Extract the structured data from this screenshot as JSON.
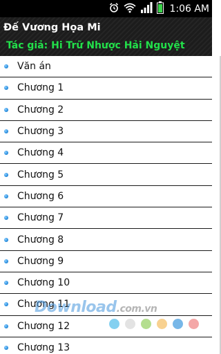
{
  "status_bar": {
    "time": "1:06 AM",
    "icons": [
      "alarm-icon",
      "wifi-icon",
      "signal-icon",
      "battery-icon"
    ]
  },
  "header": {
    "title": "Đế Vương Họa Mi",
    "author": "Tác giả: Hi Trữ Nhược Hải Nguyệt"
  },
  "chapters": [
    {
      "label": "Văn án"
    },
    {
      "label": "Chương 1"
    },
    {
      "label": "Chương 2"
    },
    {
      "label": "Chương 3"
    },
    {
      "label": "Chương 4"
    },
    {
      "label": "Chương 5"
    },
    {
      "label": "Chương 6"
    },
    {
      "label": "Chương 7"
    },
    {
      "label": "Chương 8"
    },
    {
      "label": "Chương 9"
    },
    {
      "label": "Chương 10"
    },
    {
      "label": "Chương 11"
    },
    {
      "label": "Chương 12"
    },
    {
      "label": "Chương 13"
    }
  ],
  "watermark": {
    "brand": "Download",
    "domain": ".com.vn",
    "dot_colors": [
      "#5bc0eb",
      "#d9d9d9",
      "#9bd36a",
      "#f5c26b",
      "#4a9fe0",
      "#f08a8a"
    ]
  },
  "colors": {
    "author_text": "#22e04a",
    "header_bg": "#1c1c1c",
    "bullet": "#2a8fe0"
  }
}
